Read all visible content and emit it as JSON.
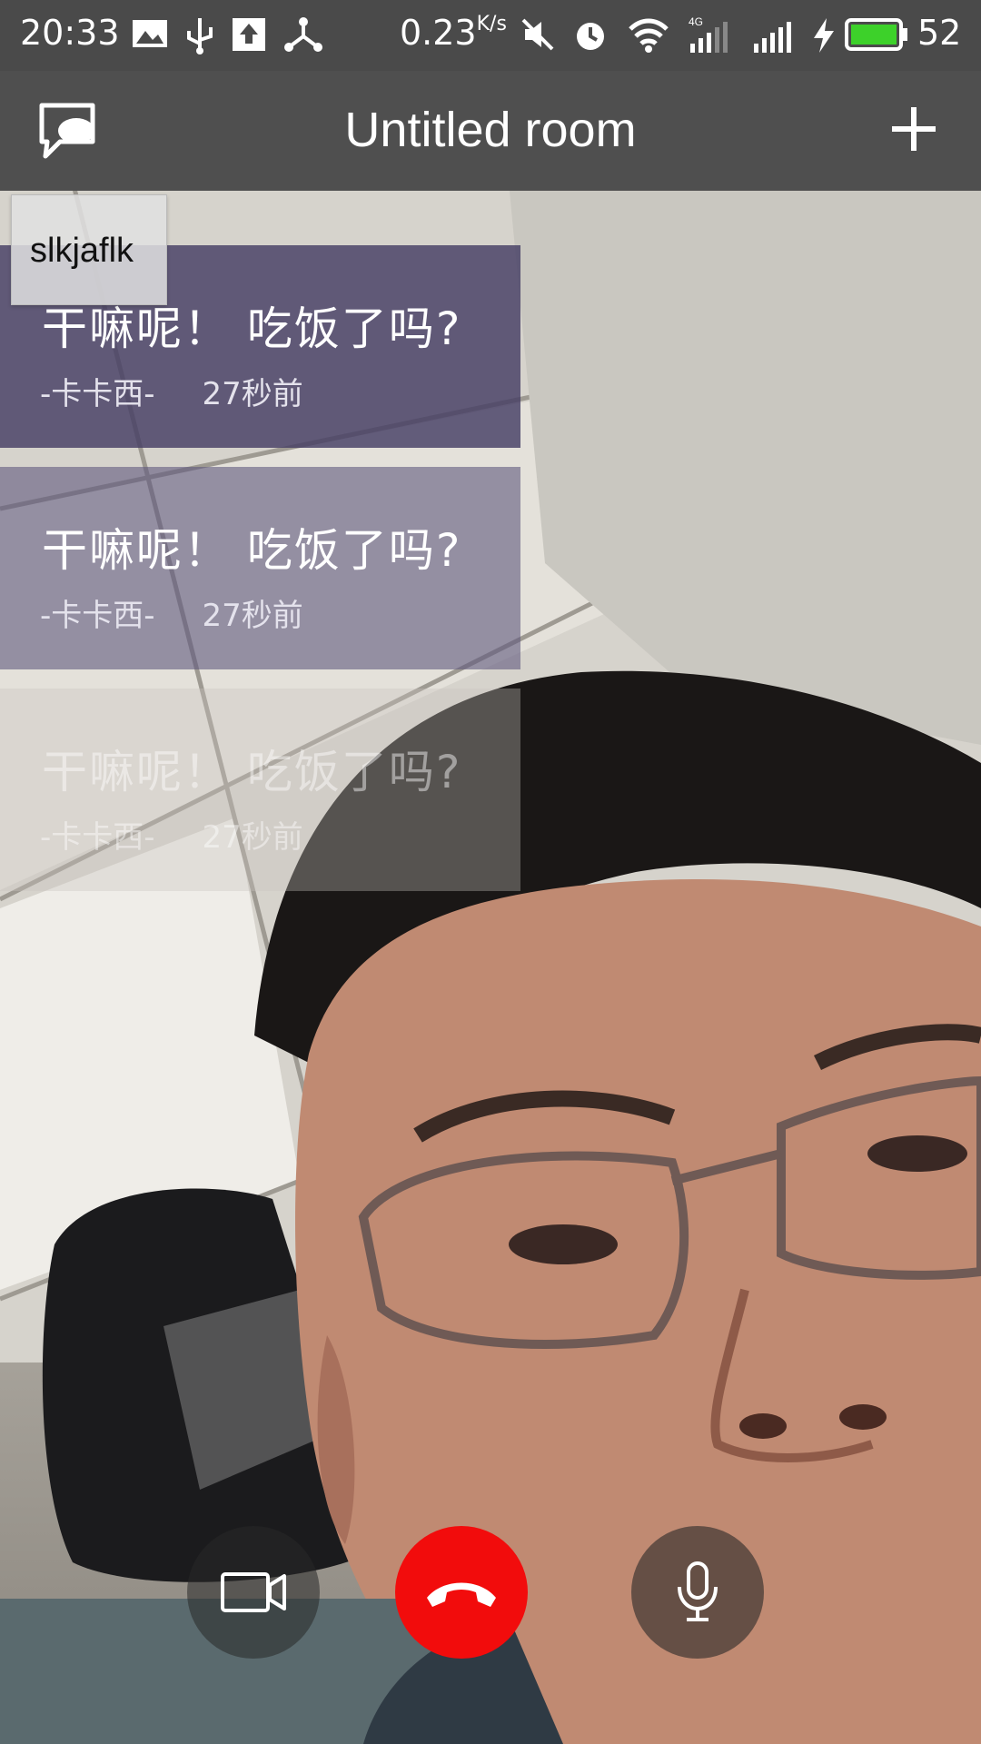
{
  "status_bar": {
    "time": "20:33",
    "speed": "0.23",
    "speed_unit": "K/s",
    "network": "4G",
    "battery": "52",
    "icons": [
      "image-icon",
      "usb-icon",
      "upload-icon",
      "share-icon",
      "mute-icon",
      "alarm-icon",
      "wifi-icon",
      "signal-icon",
      "charging-icon",
      "battery-icon"
    ]
  },
  "app_bar": {
    "title": "Untitled room",
    "left_icon": "chat-icon",
    "right_icon": "add-icon"
  },
  "peer_tile": {
    "name": "slkjaflk"
  },
  "messages": [
    {
      "text": "干嘛呢！ 吃饭了吗?",
      "sender": "-卡卡西-",
      "time": "27秒前"
    },
    {
      "text": "干嘛呢！ 吃饭了吗?",
      "sender": "-卡卡西-",
      "time": "27秒前"
    },
    {
      "text": "干嘛呢！ 吃饭了吗?",
      "sender": "-卡卡西-",
      "time": "27秒前"
    }
  ],
  "controls": {
    "video_icon": "video-camera-icon",
    "hangup_icon": "hang-up-icon",
    "mute_icon": "microphone-icon",
    "hangup_color": "#f20c0c"
  }
}
